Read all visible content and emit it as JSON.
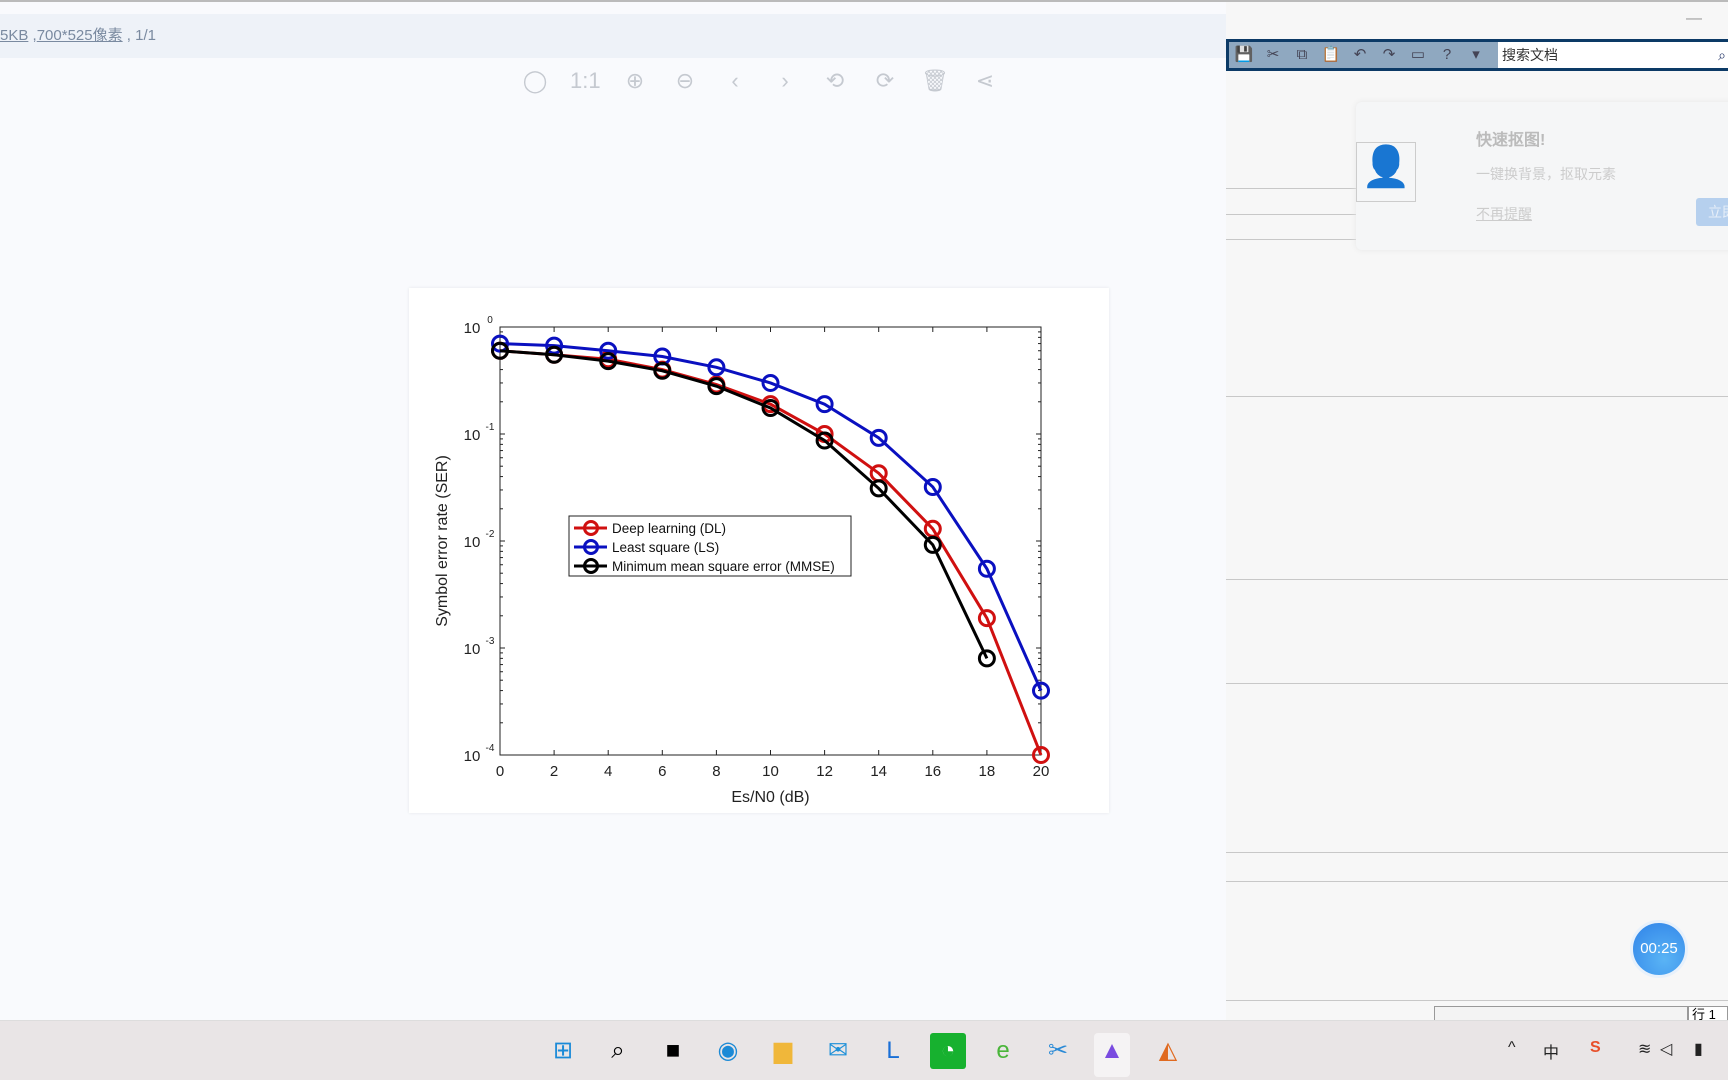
{
  "viewer": {
    "info_size": "5KB",
    "info_dims": "700*525像素",
    "info_page": ", 1/1",
    "tools": [
      {
        "icon": "mouse-icon",
        "g": "◯"
      },
      {
        "icon": "actual-size-icon",
        "g": "1:1"
      },
      {
        "icon": "zoom-in-icon",
        "g": "⊕"
      },
      {
        "icon": "zoom-out-icon",
        "g": "⊖"
      },
      {
        "icon": "previous-icon",
        "g": "‹"
      },
      {
        "icon": "next-icon",
        "g": "›"
      },
      {
        "icon": "rotate-left-icon",
        "g": "⟲"
      },
      {
        "icon": "rotate-right-icon",
        "g": "⟳"
      },
      {
        "icon": "delete-icon",
        "g": "🗑"
      },
      {
        "icon": "share-icon",
        "g": "⋖"
      }
    ]
  },
  "right": {
    "search_placeholder": "搜索文档",
    "popup_title": "快速抠图!",
    "popup_sub": "一键换背景，抠取元素",
    "popup_dismiss": "不再提醒",
    "popup_button": "立即",
    "status_row": "行 1",
    "timer": "00:25"
  },
  "chart_data": {
    "type": "line",
    "title": "",
    "xlabel": "Es/N0 (dB)",
    "ylabel": "Symbol error rate (SER)",
    "xlim": [
      0,
      20
    ],
    "ylim": [
      0.0001,
      1
    ],
    "yscale": "log",
    "xticks": [
      0,
      2,
      4,
      6,
      8,
      10,
      12,
      14,
      16,
      18,
      20
    ],
    "yticks": [
      {
        "base": "10",
        "exp": "0"
      },
      {
        "base": "10",
        "exp": "-1"
      },
      {
        "base": "10",
        "exp": "-2"
      },
      {
        "base": "10",
        "exp": "-3"
      },
      {
        "base": "10",
        "exp": "-4"
      }
    ],
    "legend_position": "center-left",
    "series": [
      {
        "name": "Deep learning (DL)",
        "color": "#d01010",
        "x": [
          0,
          2,
          4,
          6,
          8,
          10,
          12,
          14,
          16,
          18,
          20
        ],
        "y": [
          0.6,
          0.55,
          0.5,
          0.4,
          0.29,
          0.19,
          0.1,
          0.043,
          0.013,
          0.0019,
          0.0001
        ]
      },
      {
        "name": "Least square (LS)",
        "color": "#0a10c0",
        "x": [
          0,
          2,
          4,
          6,
          8,
          10,
          12,
          14,
          16,
          18,
          20
        ],
        "y": [
          0.7,
          0.67,
          0.6,
          0.53,
          0.42,
          0.3,
          0.19,
          0.092,
          0.032,
          0.0055,
          0.0004
        ]
      },
      {
        "name": "Minimum mean square error (MMSE)",
        "color": "#000000",
        "x": [
          0,
          2,
          4,
          6,
          8,
          10,
          12,
          14,
          16,
          18
        ],
        "y": [
          0.6,
          0.55,
          0.48,
          0.39,
          0.28,
          0.175,
          0.087,
          0.031,
          0.0092,
          0.0008
        ]
      }
    ]
  }
}
